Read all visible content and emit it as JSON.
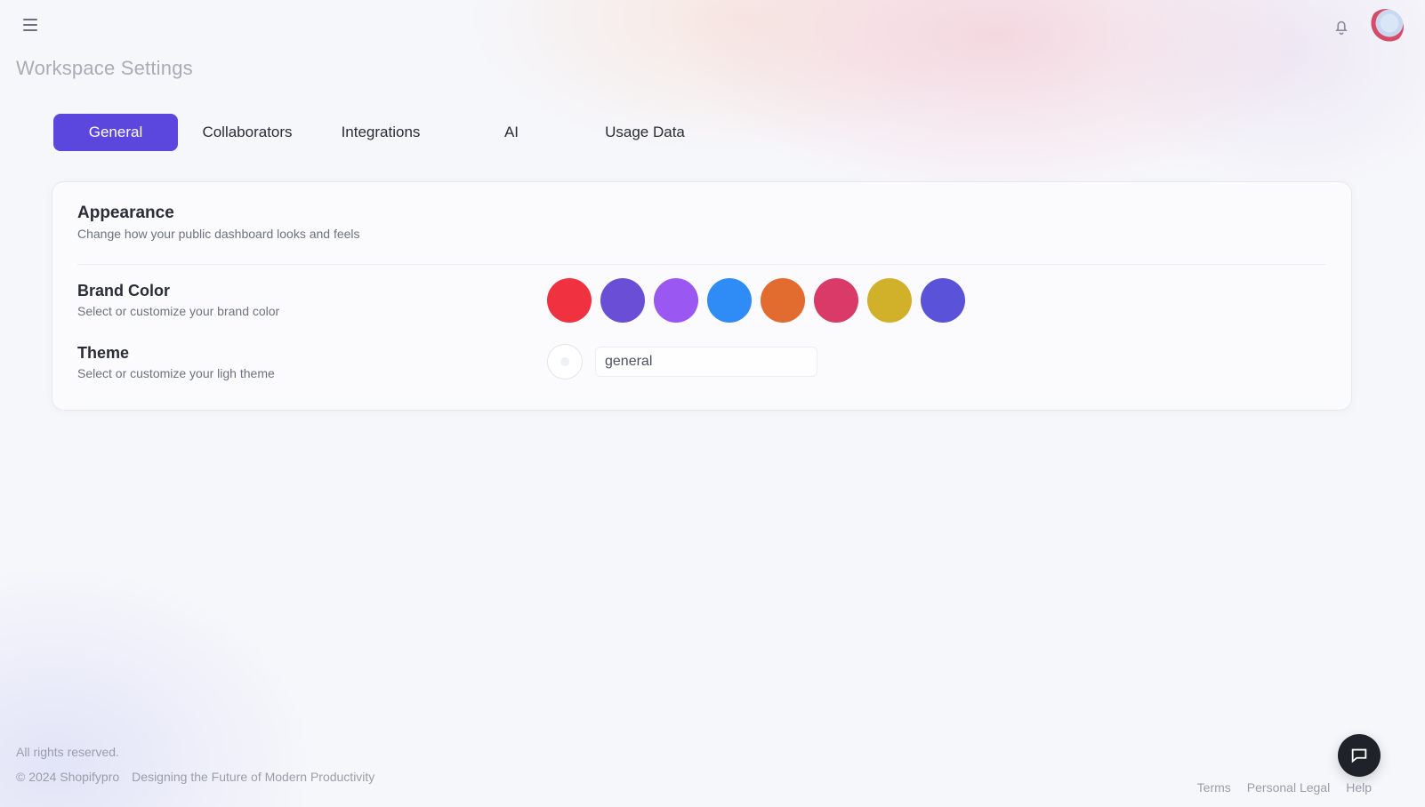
{
  "header": {
    "page_title": "Workspace Settings",
    "menu_icon": "hamburger-menu-icon",
    "notification_icon": "bell-icon",
    "avatar_icon": "user-avatar"
  },
  "tabs": [
    {
      "label": "General",
      "active": true
    },
    {
      "label": "Collaborators",
      "active": false
    },
    {
      "label": "Integrations",
      "active": false
    },
    {
      "label": "AI",
      "active": false
    },
    {
      "label": "Usage Data",
      "active": false
    }
  ],
  "appearance": {
    "title": "Appearance",
    "subtitle": "Change how your public dashboard looks and feels",
    "brand_color": {
      "label": "Brand Color",
      "description": "Select or customize your brand color",
      "swatches": [
        "#f0313f",
        "#6a4fd6",
        "#9b57f2",
        "#2f8cf6",
        "#e26c2f",
        "#d93a67",
        "#d1b02a",
        "#5a52d9"
      ]
    },
    "theme": {
      "label": "Theme",
      "description": "Select or customize your ligh theme",
      "value": "general"
    }
  },
  "footer": {
    "rights": "All rights reserved.",
    "copyright": "© 2024 Shopifypro",
    "tagline": "Designing the Future of Modern Productivity",
    "links": [
      "Terms",
      "Personal Legal",
      "Help"
    ]
  },
  "chat_button": {
    "icon": "chat-bubble-icon"
  }
}
